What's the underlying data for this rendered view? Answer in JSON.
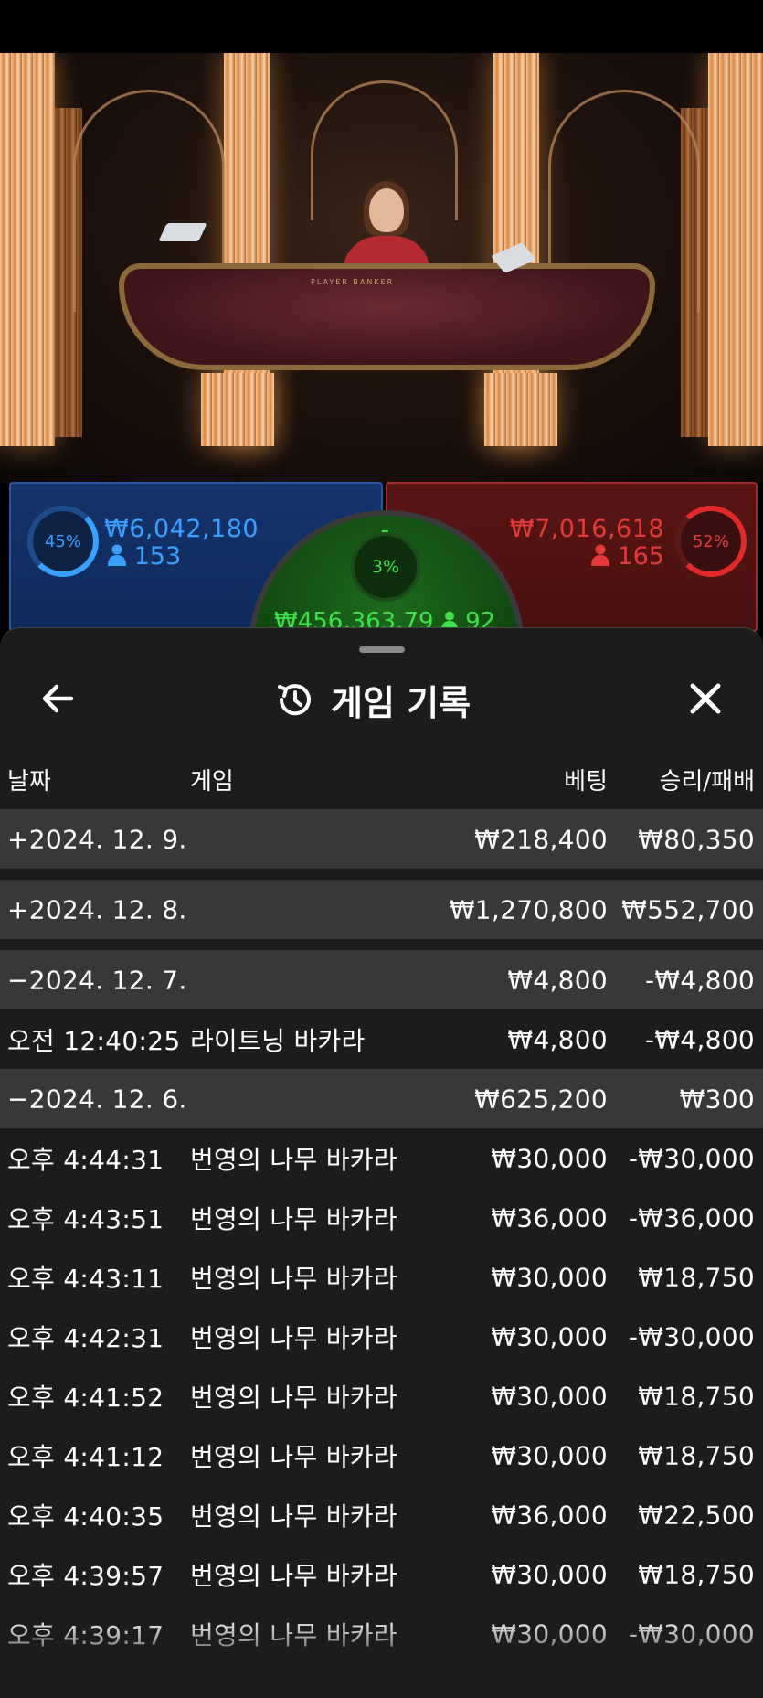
{
  "video": {
    "table_label": "PLAYER  BANKER"
  },
  "bets": {
    "player": {
      "percent": "45%",
      "amount": "₩6,042,180",
      "players": "153",
      "color": "#3aa0ff"
    },
    "banker": {
      "percent": "52%",
      "amount": "₩7,016,618",
      "players": "165",
      "color": "#e03a3a"
    },
    "tie": {
      "percent": "3%",
      "amount": "₩456,363.79",
      "players": "92",
      "color": "#3fe04a"
    }
  },
  "sheet": {
    "title": "게임 기록",
    "columns": {
      "date": "날짜",
      "game": "게임",
      "bet": "베팅",
      "result": "승리/패배"
    },
    "rows": [
      {
        "type": "day",
        "date": "+2024. 12. 9.",
        "game": "",
        "bet": "₩218,400",
        "result": "₩80,350"
      },
      {
        "type": "day",
        "date": "+2024. 12. 8.",
        "game": "",
        "bet": "₩1,270,800",
        "result": "₩552,700"
      },
      {
        "type": "day",
        "date": "−2024. 12. 7.",
        "game": "",
        "bet": "₩4,800",
        "result": "-₩4,800"
      },
      {
        "type": "item",
        "date": "오전 12:40:25",
        "game": "라이트닝 바카라",
        "bet": "₩4,800",
        "result": "-₩4,800"
      },
      {
        "type": "day",
        "date": "−2024. 12. 6.",
        "game": "",
        "bet": "₩625,200",
        "result": "₩300"
      },
      {
        "type": "item",
        "date": "오후 4:44:31",
        "game": "번영의 나무 바카라",
        "bet": "₩30,000",
        "result": "-₩30,000"
      },
      {
        "type": "item",
        "date": "오후 4:43:51",
        "game": "번영의 나무 바카라",
        "bet": "₩36,000",
        "result": "-₩36,000"
      },
      {
        "type": "item",
        "date": "오후 4:43:11",
        "game": "번영의 나무 바카라",
        "bet": "₩30,000",
        "result": "₩18,750"
      },
      {
        "type": "item",
        "date": "오후 4:42:31",
        "game": "번영의 나무 바카라",
        "bet": "₩30,000",
        "result": "-₩30,000"
      },
      {
        "type": "item",
        "date": "오후 4:41:52",
        "game": "번영의 나무 바카라",
        "bet": "₩30,000",
        "result": "₩18,750"
      },
      {
        "type": "item",
        "date": "오후 4:41:12",
        "game": "번영의 나무 바카라",
        "bet": "₩30,000",
        "result": "₩18,750"
      },
      {
        "type": "item",
        "date": "오후 4:40:35",
        "game": "번영의 나무 바카라",
        "bet": "₩36,000",
        "result": "₩22,500"
      },
      {
        "type": "item",
        "date": "오후 4:39:57",
        "game": "번영의 나무 바카라",
        "bet": "₩30,000",
        "result": "₩18,750"
      },
      {
        "type": "item",
        "date": "오후 4:39:17",
        "game": "번영의 나무 바카라",
        "bet": "₩30,000",
        "result": "-₩30,000"
      }
    ]
  },
  "icons": {
    "back": "arrow-left-icon",
    "history": "history-clock-icon",
    "close": "close-icon",
    "person": "person-icon"
  }
}
